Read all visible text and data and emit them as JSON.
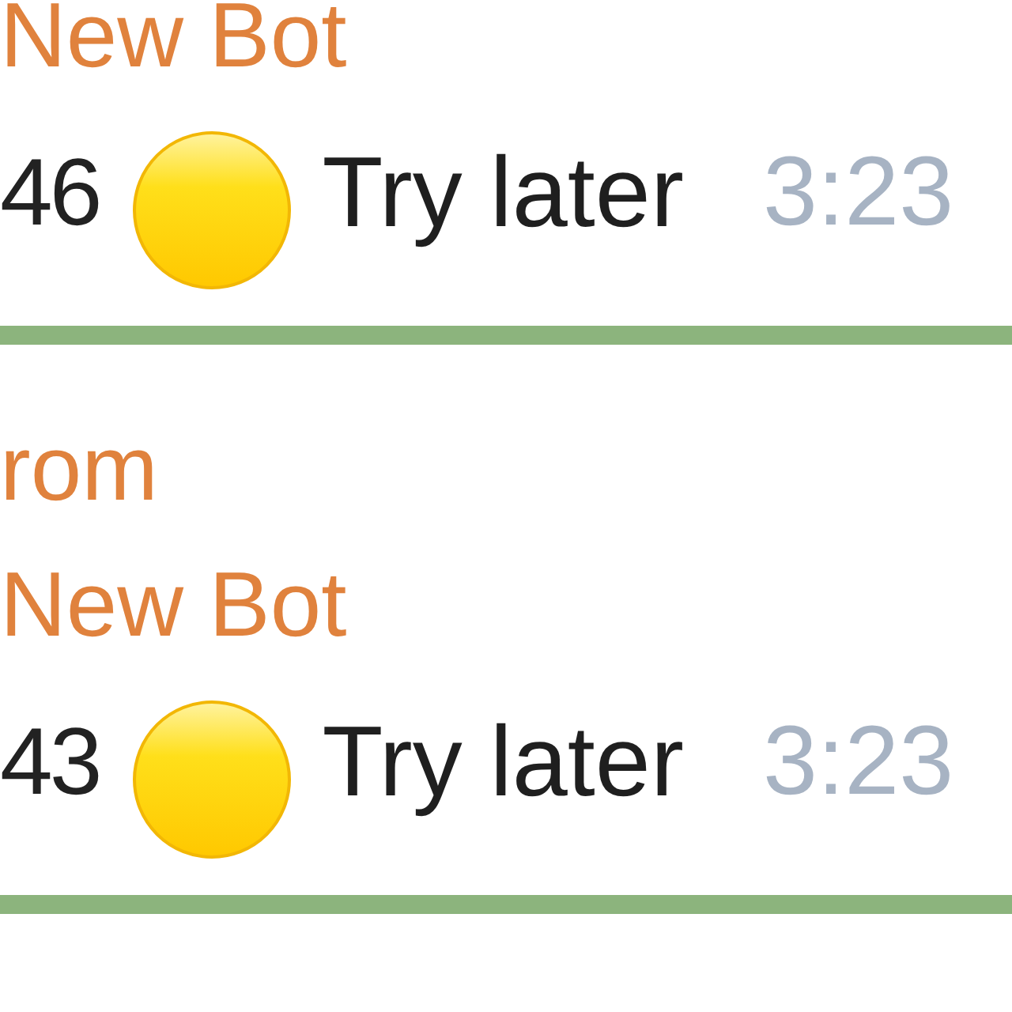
{
  "messages": [
    {
      "sender": "New Bot",
      "fragment": "46",
      "text": "Try later",
      "time": "3:23"
    },
    {
      "forward_label": "rom",
      "sender": "New Bot",
      "fragment": "43",
      "text": "Try later",
      "time": "3:23"
    }
  ]
}
